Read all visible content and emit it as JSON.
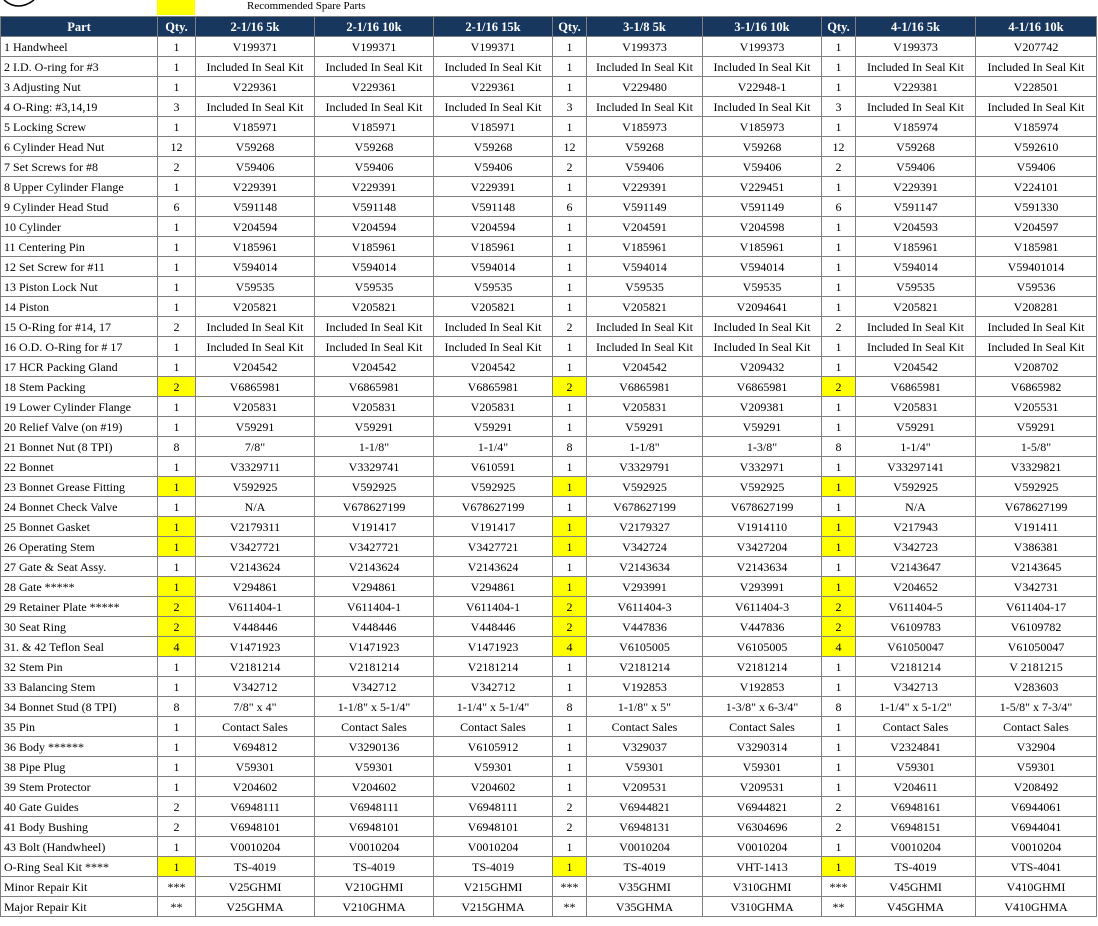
{
  "legend": {
    "label": "Recommended Spare Parts",
    "highlight_color": "#ffff00"
  },
  "header_color": "#17375e",
  "columns": [
    "Part",
    "Qty.",
    "2-1/16 5k",
    "2-1/16 10k",
    "2-1/16 15k",
    "Qty.",
    "3-1/8 5k",
    "3-1/16 10k",
    "Qty.",
    "4-1/16 5k",
    "4-1/16 10k"
  ],
  "rows": [
    {
      "cells": [
        "1 Handwheel",
        "1",
        "V199371",
        "V199371",
        "V199371",
        "1",
        "V199373",
        "V199373",
        "1",
        "V199373",
        "V207742"
      ],
      "hl": false
    },
    {
      "cells": [
        "2 I.D. O-ring for #3",
        "1",
        "Included In Seal Kit",
        "Included In Seal Kit",
        "Included In Seal Kit",
        "1",
        "Included In Seal Kit",
        "Included In Seal Kit",
        "1",
        "Included In Seal Kit",
        "Included In Seal Kit"
      ],
      "hl": false
    },
    {
      "cells": [
        "3 Adjusting Nut",
        "1",
        "V229361",
        "V229361",
        "V229361",
        "1",
        "V229480",
        "V22948-1",
        "1",
        "V229381",
        "V228501"
      ],
      "hl": false
    },
    {
      "cells": [
        "4 O-Ring: #3,14,19",
        "3",
        "Included In Seal Kit",
        "Included In Seal Kit",
        "Included In Seal Kit",
        "3",
        "Included In Seal Kit",
        "Included In Seal Kit",
        "3",
        "Included In Seal Kit",
        "Included In Seal Kit"
      ],
      "hl": false
    },
    {
      "cells": [
        "5 Locking Screw",
        "1",
        "V185971",
        "V185971",
        "V185971",
        "1",
        "V185973",
        "V185973",
        "1",
        "V185974",
        "V185974"
      ],
      "hl": false
    },
    {
      "cells": [
        "6 Cylinder Head Nut",
        "12",
        "V59268",
        "V59268",
        "V59268",
        "12",
        "V59268",
        "V59268",
        "12",
        "V59268",
        "V592610"
      ],
      "hl": false
    },
    {
      "cells": [
        "7 Set Screws for #8",
        "2",
        "V59406",
        "V59406",
        "V59406",
        "2",
        "V59406",
        "V59406",
        "2",
        "V59406",
        "V59406"
      ],
      "hl": false
    },
    {
      "cells": [
        "8 Upper Cylinder Flange",
        "1",
        "V229391",
        "V229391",
        "V229391",
        "1",
        "V229391",
        "V229451",
        "1",
        "V229391",
        "V224101"
      ],
      "hl": false
    },
    {
      "cells": [
        "9 Cylinder Head Stud",
        "6",
        "V591148",
        "V591148",
        "V591148",
        "6",
        "V591149",
        "V591149",
        "6",
        "V591147",
        "V591330"
      ],
      "hl": false
    },
    {
      "cells": [
        "10 Cylinder",
        "1",
        "V204594",
        "V204594",
        "V204594",
        "1",
        "V204591",
        "V204598",
        "1",
        "V204593",
        "V204597"
      ],
      "hl": false
    },
    {
      "cells": [
        "11 Centering Pin",
        "1",
        "V185961",
        "V185961",
        "V185961",
        "1",
        "V185961",
        "V185961",
        "1",
        "V185961",
        "V185981"
      ],
      "hl": false
    },
    {
      "cells": [
        "12 Set Screw for #11",
        "1",
        "V594014",
        "V594014",
        "V594014",
        "1",
        "V594014",
        "V594014",
        "1",
        "V594014",
        "V59401014"
      ],
      "hl": false
    },
    {
      "cells": [
        "13 Piston Lock Nut",
        "1",
        "V59535",
        "V59535",
        "V59535",
        "1",
        "V59535",
        "V59535",
        "1",
        "V59535",
        "V59536"
      ],
      "hl": false
    },
    {
      "cells": [
        "14 Piston",
        "1",
        "V205821",
        "V205821",
        "V205821",
        "1",
        "V205821",
        "V2094641",
        "1",
        "V205821",
        "V208281"
      ],
      "hl": false
    },
    {
      "cells": [
        "15 O-Ring for #14, 17",
        "2",
        "Included In Seal Kit",
        "Included In Seal Kit",
        "Included In Seal Kit",
        "2",
        "Included In Seal Kit",
        "Included In Seal Kit",
        "2",
        "Included In Seal Kit",
        "Included In Seal Kit"
      ],
      "hl": false
    },
    {
      "cells": [
        "16 O.D. O-Ring for # 17",
        "1",
        "Included In Seal Kit",
        "Included In Seal Kit",
        "Included In Seal Kit",
        "1",
        "Included In Seal Kit",
        "Included In Seal Kit",
        "1",
        "Included In Seal Kit",
        "Included In Seal Kit"
      ],
      "hl": false
    },
    {
      "cells": [
        "17 HCR Packing Gland",
        "1",
        "V204542",
        "V204542",
        "V204542",
        "1",
        "V204542",
        "V209432",
        "1",
        "V204542",
        "V208702"
      ],
      "hl": false
    },
    {
      "cells": [
        "18 Stem Packing",
        "2",
        "V6865981",
        "V6865981",
        "V6865981",
        "2",
        "V6865981",
        "V6865981",
        "2",
        "V6865981",
        "V6865982"
      ],
      "hl": true
    },
    {
      "cells": [
        "19 Lower Cylinder Flange",
        "1",
        "V205831",
        "V205831",
        "V205831",
        "1",
        "V205831",
        "V209381",
        "1",
        "V205831",
        "V205531"
      ],
      "hl": false
    },
    {
      "cells": [
        "20 Relief Valve (on #19)",
        "1",
        "V59291",
        "V59291",
        "V59291",
        "1",
        "V59291",
        "V59291",
        "1",
        "V59291",
        "V59291"
      ],
      "hl": false
    },
    {
      "cells": [
        "21 Bonnet Nut (8 TPI)",
        "8",
        "7/8\"",
        "1-1/8\"",
        "1-1/4\"",
        "8",
        "1-1/8\"",
        "1-3/8\"",
        "8",
        "1-1/4\"",
        "1-5/8\""
      ],
      "hl": false
    },
    {
      "cells": [
        "22 Bonnet",
        "1",
        "V3329711",
        "V3329741",
        "V610591",
        "1",
        "V3329791",
        "V332971",
        "1",
        "V33297141",
        "V3329821"
      ],
      "hl": false
    },
    {
      "cells": [
        "23 Bonnet Grease Fitting",
        "1",
        "V592925",
        "V592925",
        "V592925",
        "1",
        "V592925",
        "V592925",
        "1",
        "V592925",
        "V592925"
      ],
      "hl": true
    },
    {
      "cells": [
        "24 Bonnet Check Valve",
        "1",
        "N/A",
        "V678627199",
        "V678627199",
        "1",
        "V678627199",
        "V678627199",
        "1",
        "N/A",
        "V678627199"
      ],
      "hl": false
    },
    {
      "cells": [
        "25 Bonnet Gasket",
        "1",
        "V2179311",
        "V191417",
        "V191417",
        "1",
        "V2179327",
        "V1914110",
        "1",
        "V217943",
        "V191411"
      ],
      "hl": true
    },
    {
      "cells": [
        "26 Operating Stem",
        "1",
        "V3427721",
        "V3427721",
        "V3427721",
        "1",
        "V342724",
        "V3427204",
        "1",
        "V342723",
        "V386381"
      ],
      "hl": true
    },
    {
      "cells": [
        "27 Gate & Seat Assy.",
        "1",
        "V2143624",
        "V2143624",
        "V2143624",
        "1",
        "V2143634",
        "V2143634",
        "1",
        "V2143647",
        "V2143645"
      ],
      "hl": false
    },
    {
      "cells": [
        "28 Gate *****",
        "1",
        "V294861",
        "V294861",
        "V294861",
        "1",
        "V293991",
        "V293991",
        "1",
        "V204652",
        "V342731"
      ],
      "hl": true
    },
    {
      "cells": [
        "29 Retainer Plate *****",
        "2",
        "V611404-1",
        "V611404-1",
        "V611404-1",
        "2",
        "V611404-3",
        "V611404-3",
        "2",
        "V611404-5",
        "V611404-17"
      ],
      "hl": true
    },
    {
      "cells": [
        "30 Seat Ring",
        "2",
        "V448446",
        "V448446",
        "V448446",
        "2",
        "V447836",
        "V447836",
        "2",
        "V6109783",
        "V6109782"
      ],
      "hl": true
    },
    {
      "cells": [
        "31. & 42 Teflon Seal",
        "4",
        "V1471923",
        "V1471923",
        "V1471923",
        "4",
        "V6105005",
        "V6105005",
        "4",
        "V61050047",
        "V61050047"
      ],
      "hl": true
    },
    {
      "cells": [
        "32 Stem Pin",
        "1",
        "V2181214",
        "V2181214",
        "V2181214",
        "1",
        "V2181214",
        "V2181214",
        "1",
        "V2181214",
        "V 2181215"
      ],
      "hl": false
    },
    {
      "cells": [
        "33 Balancing Stem",
        "1",
        "V342712",
        "V342712",
        "V342712",
        "1",
        "V192853",
        "V192853",
        "1",
        "V342713",
        "V283603"
      ],
      "hl": false
    },
    {
      "cells": [
        "34 Bonnet Stud (8 TPI)",
        "8",
        "7/8\" x 4\"",
        "1-1/8\" x 5-1/4\"",
        "1-1/4\" x 5-1/4\"",
        "8",
        "1-1/8\" x 5\"",
        "1-3/8\" x 6-3/4\"",
        "8",
        "1-1/4\" x 5-1/2\"",
        "1-5/8\" x 7-3/4\""
      ],
      "hl": false
    },
    {
      "cells": [
        "35 Pin",
        "1",
        "Contact Sales",
        "Contact Sales",
        "Contact Sales",
        "1",
        "Contact Sales",
        "Contact Sales",
        "1",
        "Contact Sales",
        "Contact Sales"
      ],
      "hl": false
    },
    {
      "cells": [
        "36 Body ******",
        "1",
        "V694812",
        "V3290136",
        "V6105912",
        "1",
        "V329037",
        "V3290314",
        "1",
        "V2324841",
        "V32904"
      ],
      "hl": false
    },
    {
      "cells": [
        "38 Pipe Plug",
        "1",
        "V59301",
        "V59301",
        "V59301",
        "1",
        "V59301",
        "V59301",
        "1",
        "V59301",
        "V59301"
      ],
      "hl": false
    },
    {
      "cells": [
        "39 Stem Protector",
        "1",
        "V204602",
        "V204602",
        "V204602",
        "1",
        "V209531",
        "V209531",
        "1",
        "V204611",
        "V208492"
      ],
      "hl": false
    },
    {
      "cells": [
        "40 Gate Guides",
        "2",
        "V6948111",
        "V6948111",
        "V6948111",
        "2",
        "V6944821",
        "V6944821",
        "2",
        "V6948161",
        "V6944061"
      ],
      "hl": false
    },
    {
      "cells": [
        "41 Body Bushing",
        "2",
        "V6948101",
        "V6948101",
        "V6948101",
        "2",
        "V6948131",
        "V6304696",
        "2",
        "V6948151",
        "V6944041"
      ],
      "hl": false
    },
    {
      "cells": [
        "43 Bolt (Handwheel)",
        "1",
        "V0010204",
        "V0010204",
        "V0010204",
        "1",
        "V0010204",
        "V0010204",
        "1",
        "V0010204",
        "V0010204"
      ],
      "hl": false
    },
    {
      "cells": [
        "O-Ring Seal Kit ****",
        "1",
        "TS-4019",
        "TS-4019",
        "TS-4019",
        "1",
        "TS-4019",
        "VHT-1413",
        "1",
        "TS-4019",
        "VTS-4041"
      ],
      "hl": true
    },
    {
      "cells": [
        "Minor Repair Kit",
        "***",
        "V25GHMI",
        "V210GHMI",
        "V215GHMI",
        "***",
        "V35GHMI",
        "V310GHMI",
        "***",
        "V45GHMI",
        "V410GHMI"
      ],
      "hl": false
    },
    {
      "cells": [
        "Major Repair Kit",
        "**",
        "V25GHMA",
        "V210GHMA",
        "V215GHMA",
        "**",
        "V35GHMA",
        "V310GHMA",
        "**",
        "V45GHMA",
        "V410GHMA"
      ],
      "hl": false
    }
  ]
}
